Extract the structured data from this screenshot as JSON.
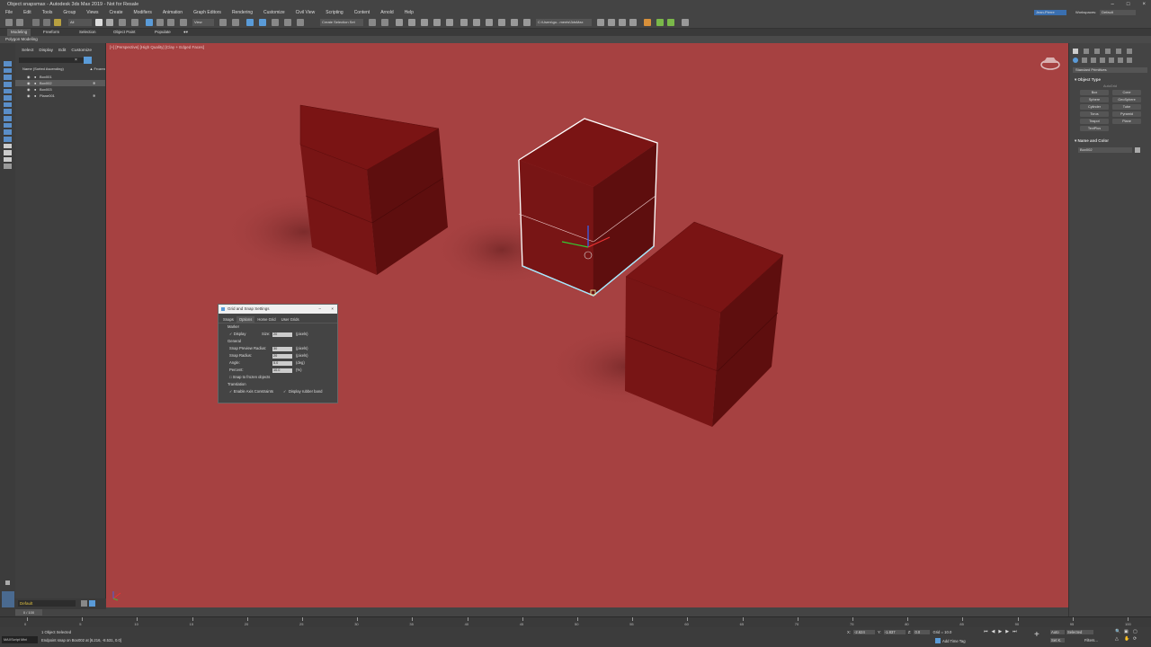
{
  "window": {
    "title": "Object snapsmax - Autodesk 3ds Max 2019 - Not for Resale"
  },
  "menu": [
    "File",
    "Edit",
    "Tools",
    "Group",
    "Views",
    "Create",
    "Modifiers",
    "Animation",
    "Graph Editors",
    "Rendering",
    "Customize",
    "Civil View",
    "Scripting",
    "Content",
    "Arnold",
    "Help"
  ],
  "toolbar": {
    "selection_set_placeholder": "Create Selection Set",
    "path": "C:\\Users\\gu...ments\\3dsMax",
    "workspace_label": "Workspaces:",
    "workspace_value": "Default",
    "user": "Jean-Pierre"
  },
  "ribbon": {
    "tabs": [
      "Modeling",
      "Freeform",
      "Selection",
      "Object Paint",
      "Populate"
    ],
    "subtitle": "Polygon Modeling"
  },
  "scene_explorer": {
    "tabs": [
      "Select",
      "Display",
      "Edit",
      "Customize"
    ],
    "header": "Name (Sorted Ascending)",
    "frozen_header": "▲ Frozen",
    "rows": [
      {
        "name": "Box001",
        "selected": false
      },
      {
        "name": "Box002",
        "selected": true
      },
      {
        "name": "Box003",
        "selected": false
      },
      {
        "name": "Plane001",
        "selected": false
      }
    ]
  },
  "viewport": {
    "label": "[+] [Perspective] [High Quality] [Clay + Edged Faces]"
  },
  "command_panel": {
    "dropdown": "Standard Primitives",
    "object_type_title": "Object Type",
    "autogrid": "AutoGrid",
    "primitives": [
      "Box",
      "Cone",
      "Sphere",
      "GeoSphere",
      "Cylinder",
      "Tube",
      "Torus",
      "Pyramid",
      "Teapot",
      "Plane",
      "TextPlus"
    ],
    "name_color_title": "Name and Color",
    "object_name": "Box002"
  },
  "snap_dialog": {
    "title": "Grid and Snap Settings",
    "tabs": [
      "Snaps",
      "Options",
      "Home Grid",
      "User Grids"
    ],
    "marker_label": "Marker",
    "display_label": "Display",
    "size_label": "Size:",
    "size_value": "20",
    "size_unit": "(pixels)",
    "general_label": "General",
    "preview_radius_label": "Snap Preview Radius:",
    "preview_radius_value": "30",
    "preview_radius_unit": "(pixels)",
    "snap_radius_label": "Snap Radius:",
    "snap_radius_value": "20",
    "snap_radius_unit": "(pixels)",
    "angle_label": "Angle:",
    "angle_value": "5.0",
    "angle_unit": "(deg)",
    "percent_label": "Percent:",
    "percent_value": "10.0",
    "percent_unit": "(%)",
    "frozen_label": "Snap to frozen objects",
    "translation_label": "Translation",
    "axis_constraints_label": "Enable Axis Constraints",
    "rubber_band_label": "Display rubber band"
  },
  "layer": {
    "name": "Default"
  },
  "timeline": {
    "frame": "0 / 100",
    "ticks": [
      "0",
      "5",
      "10",
      "15",
      "20",
      "25",
      "30",
      "35",
      "40",
      "45",
      "50",
      "55",
      "60",
      "65",
      "70",
      "75",
      "80",
      "85",
      "90",
      "95",
      "100"
    ]
  },
  "status": {
    "selected": "1 Object Selected",
    "message": "Endpoint snap on Box002 at [6.216, -8.531, 0.0]",
    "maxscript": "MAXScript Mini",
    "x_label": "X:",
    "x_value": "-2.624",
    "y_label": "Y:",
    "y_value": "-1.837",
    "z_label": "Z:",
    "z_value": "0.0",
    "grid": "Grid = 10.0",
    "add_time_tag": "Add Time Tag",
    "auto": "Auto",
    "set_key": "Set K.",
    "selected_dropdown": "Selected",
    "filters": "Filters..."
  },
  "colors": {
    "viewport_bg": "#a64141",
    "box_face": "#7a1414",
    "selection": "#ffffff",
    "accent": "#5a9bd8"
  }
}
